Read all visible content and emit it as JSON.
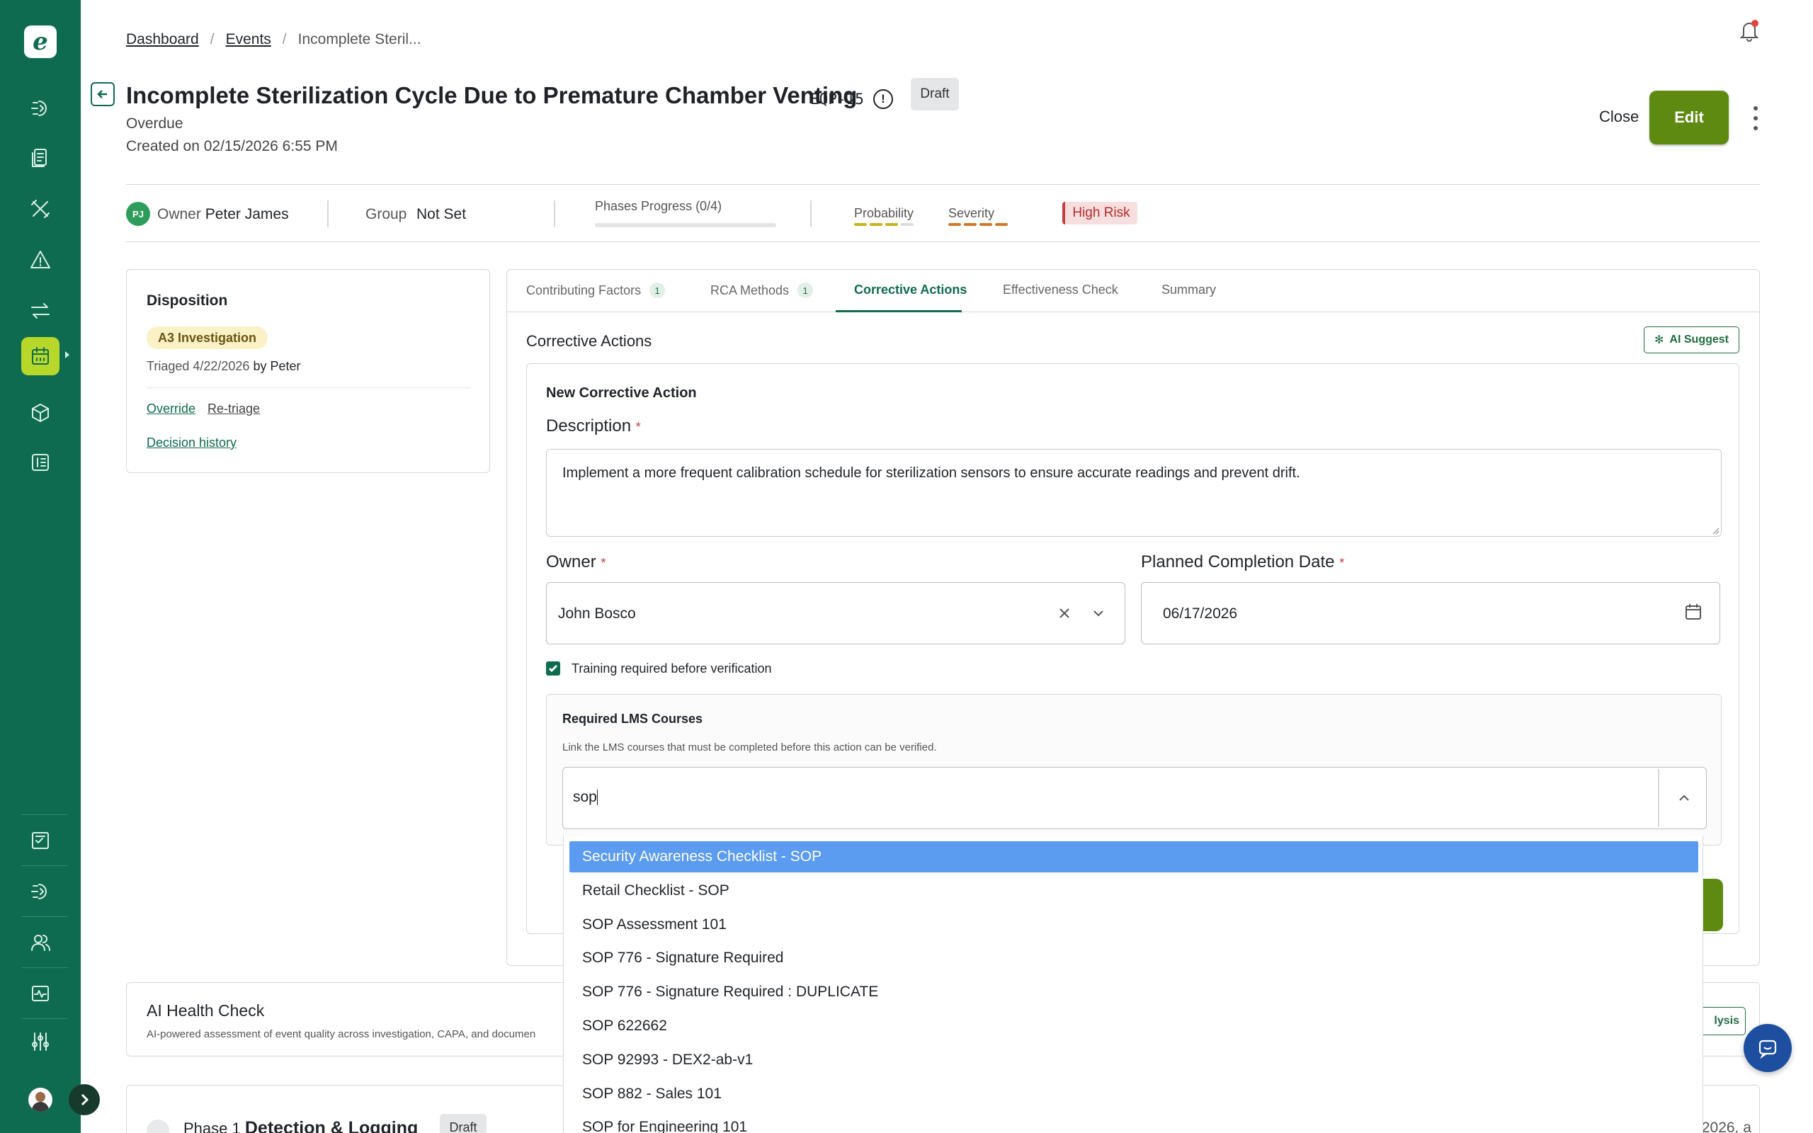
{
  "breadcrumb": {
    "items": [
      "Dashboard",
      "Events",
      "Incomplete Steril..."
    ]
  },
  "event": {
    "title": "Incomplete Sterilization Cycle Due to Premature Chamber Venting",
    "id": "EQP-15",
    "status_badge": "Draft",
    "due_status": "Overdue",
    "created": "Created on 02/15/2026 6:55 PM"
  },
  "header_actions": {
    "close_label": "Close",
    "edit_label": "Edit"
  },
  "infobar": {
    "owner_initials": "PJ",
    "owner_label": "Owner",
    "owner_name": "Peter James",
    "group_label": "Group",
    "group_value": "Not Set",
    "phases_label": "Phases Progress (0/4)",
    "phases_progress": 0,
    "probability_label": "Probability",
    "probability_level": 3,
    "severity_label": "Severity",
    "severity_level": 4,
    "risk_badge": "High Risk",
    "colors": {
      "probability": "#c9b21c",
      "severity": "#d0782a",
      "inactive": "#d9dbdd"
    }
  },
  "disposition": {
    "title": "Disposition",
    "badge": "A3 Investigation",
    "triaged_prefix": "Triaged 4/22/2026",
    "triaged_by": "by Peter",
    "links": [
      "Override",
      "Re-triage"
    ],
    "history_link": "Decision history"
  },
  "tabs": [
    {
      "label": "Contributing Factors",
      "count": "1"
    },
    {
      "label": "RCA Methods",
      "count": "1"
    },
    {
      "label": "Corrective Actions",
      "active": true
    },
    {
      "label": "Effectiveness Check"
    },
    {
      "label": "Summary"
    }
  ],
  "corrective_actions": {
    "title": "Corrective Actions",
    "ai_suggest_label": "AI Suggest",
    "form": {
      "title": "New Corrective Action",
      "description_label": "Description",
      "description_value": "Implement a more frequent calibration schedule for sterilization sensors to ensure accurate readings and prevent drift.",
      "owner_label": "Owner",
      "owner_value": "John Bosco",
      "date_label": "Planned Completion Date",
      "date_value": "06/17/2026",
      "training_label": "Training required before verification",
      "training_checked": true,
      "lms": {
        "title": "Required LMS Courses",
        "help": "Link the LMS courses that must be completed before this action can be verified.",
        "search_value": "sop"
      }
    }
  },
  "dropdown": {
    "options": [
      "Security Awareness Checklist - SOP",
      "Retail Checklist - SOP",
      "SOP Assessment 101",
      "SOP 776 - Signature Required",
      "SOP 776 - Signature Required : DUPLICATE",
      "SOP 622662",
      "SOP 92993 - DEX2-ab-v1",
      "SOP 882 - Sales 101",
      "SOP for Engineering 101"
    ],
    "highlighted_index": 0
  },
  "health_check": {
    "title": "AI Health Check",
    "subtitle": "AI-powered assessment of event quality across investigation, CAPA, and documen",
    "button_label": "lysis"
  },
  "phase": {
    "prefix": "Phase 1",
    "name": "Detection & Logging",
    "badge": "Draft",
    "date": "/2026, a"
  }
}
